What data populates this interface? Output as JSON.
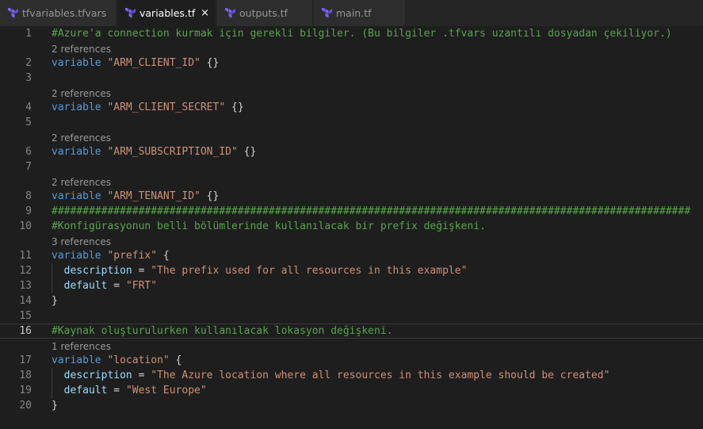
{
  "tabs": [
    {
      "label": "tfvariables.tfvars",
      "active": false,
      "icon": "terraform-icon"
    },
    {
      "label": "variables.tf",
      "active": true,
      "icon": "terraform-icon",
      "close": "×"
    },
    {
      "label": "outputs.tf",
      "active": false,
      "icon": "terraform-icon"
    },
    {
      "label": "main.tf",
      "active": false,
      "icon": "terraform-icon"
    }
  ],
  "colors": {
    "background": "#1e1e1e",
    "comment": "#57a64a",
    "keyword": "#569cd6",
    "string": "#ce9178",
    "property": "#9cdcfe",
    "terraform_icon": "#7b61ff"
  },
  "current_line": "16",
  "lines": [
    {
      "lens": null,
      "n": "1",
      "tokens": [
        {
          "t": "comment",
          "v": "#Azure'a connection kurmak için gerekli bilgiler. (Bu bilgiler .tfvars uzantılı dosyadan çekiliyor.)"
        }
      ]
    },
    {
      "lens": "2 references",
      "n": "2",
      "tokens": [
        {
          "t": "keyword",
          "v": "variable"
        },
        {
          "t": "punct",
          "v": " "
        },
        {
          "t": "string",
          "v": "\"ARM_CLIENT_ID\""
        },
        {
          "t": "punct",
          "v": " {}"
        }
      ]
    },
    {
      "lens": null,
      "n": "3",
      "tokens": []
    },
    {
      "lens": "2 references",
      "n": "4",
      "tokens": [
        {
          "t": "keyword",
          "v": "variable"
        },
        {
          "t": "punct",
          "v": " "
        },
        {
          "t": "string",
          "v": "\"ARM_CLIENT_SECRET\""
        },
        {
          "t": "punct",
          "v": " {}"
        }
      ]
    },
    {
      "lens": null,
      "n": "5",
      "tokens": []
    },
    {
      "lens": "2 references",
      "n": "6",
      "tokens": [
        {
          "t": "keyword",
          "v": "variable"
        },
        {
          "t": "punct",
          "v": " "
        },
        {
          "t": "string",
          "v": "\"ARM_SUBSCRIPTION_ID\""
        },
        {
          "t": "punct",
          "v": " {}"
        }
      ]
    },
    {
      "lens": null,
      "n": "7",
      "tokens": []
    },
    {
      "lens": "2 references",
      "n": "8",
      "tokens": [
        {
          "t": "keyword",
          "v": "variable"
        },
        {
          "t": "punct",
          "v": " "
        },
        {
          "t": "string",
          "v": "\"ARM_TENANT_ID\""
        },
        {
          "t": "punct",
          "v": " {}"
        }
      ]
    },
    {
      "lens": null,
      "n": "9",
      "tokens": [
        {
          "t": "comment",
          "v": "#######################################################################################################"
        }
      ]
    },
    {
      "lens": null,
      "n": "10",
      "tokens": [
        {
          "t": "comment",
          "v": "#Konfigürasyonun belli bölümlerinde kullanılacak bir prefix değişkeni."
        }
      ]
    },
    {
      "lens": "3 references",
      "n": "11",
      "tokens": [
        {
          "t": "keyword",
          "v": "variable"
        },
        {
          "t": "punct",
          "v": " "
        },
        {
          "t": "string",
          "v": "\"prefix\""
        },
        {
          "t": "punct",
          "v": " {"
        }
      ]
    },
    {
      "lens": null,
      "n": "12",
      "tokens": [
        {
          "t": "punct",
          "v": "  "
        },
        {
          "t": "prop",
          "v": "description"
        },
        {
          "t": "punct",
          "v": " = "
        },
        {
          "t": "string",
          "v": "\"The prefix used for all resources in this example\""
        }
      ]
    },
    {
      "lens": null,
      "n": "13",
      "tokens": [
        {
          "t": "punct",
          "v": "  "
        },
        {
          "t": "prop",
          "v": "default"
        },
        {
          "t": "punct",
          "v": " = "
        },
        {
          "t": "string",
          "v": "\"FRT\""
        }
      ]
    },
    {
      "lens": null,
      "n": "14",
      "tokens": [
        {
          "t": "punct",
          "v": "}"
        }
      ]
    },
    {
      "lens": null,
      "n": "15",
      "tokens": []
    },
    {
      "lens": null,
      "n": "16",
      "tokens": [
        {
          "t": "comment",
          "v": "#Kaynak oluşturulurken kullanılacak lokasyon değişkeni."
        }
      ]
    },
    {
      "lens": "1 references",
      "n": "17",
      "tokens": [
        {
          "t": "keyword",
          "v": "variable"
        },
        {
          "t": "punct",
          "v": " "
        },
        {
          "t": "string",
          "v": "\"location\""
        },
        {
          "t": "punct",
          "v": " {"
        }
      ]
    },
    {
      "lens": null,
      "n": "18",
      "tokens": [
        {
          "t": "punct",
          "v": "  "
        },
        {
          "t": "prop",
          "v": "description"
        },
        {
          "t": "punct",
          "v": " = "
        },
        {
          "t": "string",
          "v": "\"The Azure location where all resources in this example should be created\""
        }
      ]
    },
    {
      "lens": null,
      "n": "19",
      "tokens": [
        {
          "t": "punct",
          "v": "  "
        },
        {
          "t": "prop",
          "v": "default"
        },
        {
          "t": "punct",
          "v": " = "
        },
        {
          "t": "string",
          "v": "\"West Europe\""
        }
      ]
    },
    {
      "lens": null,
      "n": "20",
      "tokens": [
        {
          "t": "punct",
          "v": "}"
        }
      ]
    }
  ]
}
